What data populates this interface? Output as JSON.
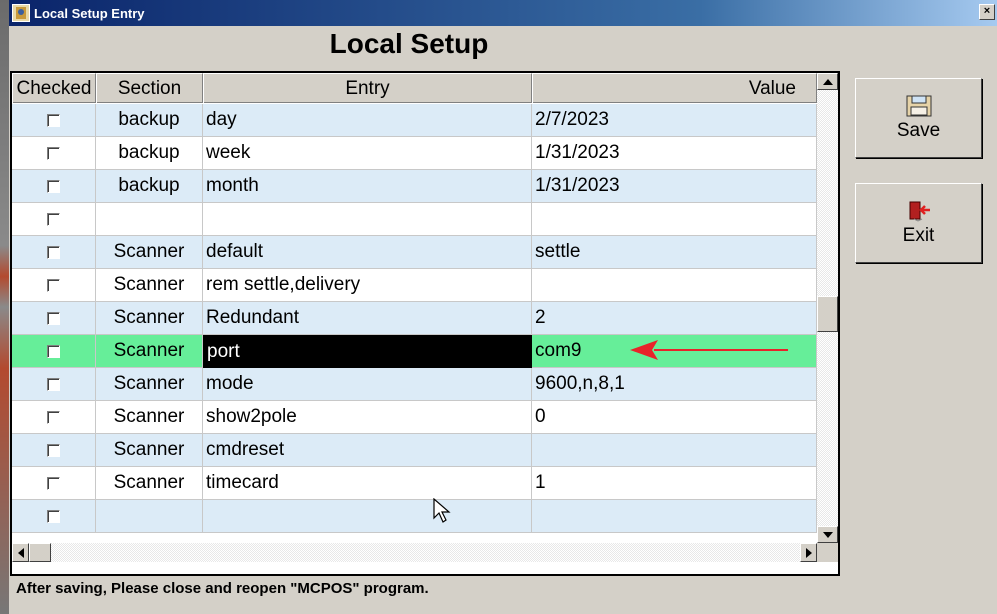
{
  "window": {
    "title": "Local Setup Entry",
    "close_label": "×"
  },
  "heading": "Local Setup",
  "grid": {
    "columns": [
      "Checked",
      "Section",
      "Entry",
      "Value"
    ],
    "rows": [
      {
        "section": "backup",
        "entry": "day",
        "value": "2/7/2023"
      },
      {
        "section": "backup",
        "entry": "week",
        "value": "1/31/2023"
      },
      {
        "section": "backup",
        "entry": "month",
        "value": "1/31/2023"
      },
      {
        "section": "",
        "entry": "",
        "value": ""
      },
      {
        "section": "Scanner",
        "entry": "default",
        "value": "settle"
      },
      {
        "section": "Scanner",
        "entry": "rem settle,delivery",
        "value": ""
      },
      {
        "section": "Scanner",
        "entry": "Redundant",
        "value": "2"
      },
      {
        "section": "Scanner",
        "entry": "port",
        "value": "com9"
      },
      {
        "section": "Scanner",
        "entry": "mode",
        "value": "9600,n,8,1"
      },
      {
        "section": "Scanner",
        "entry": "show2pole",
        "value": "0"
      },
      {
        "section": "Scanner",
        "entry": "cmdreset",
        "value": ""
      },
      {
        "section": "Scanner",
        "entry": "timecard",
        "value": "1"
      },
      {
        "section": "",
        "entry": "",
        "value": ""
      }
    ],
    "highlighted_row": 7,
    "colors": {
      "alt_row": "#dcebf7",
      "highlight_row": "#66ee99",
      "arrow": "#e8232a"
    }
  },
  "buttons": {
    "save_label": "Save",
    "exit_label": "Exit"
  },
  "icons": {
    "save": "floppy-disk-icon",
    "exit": "exit-door-icon"
  },
  "footer": "After saving, Please close and  reopen \"MCPOS\" program."
}
